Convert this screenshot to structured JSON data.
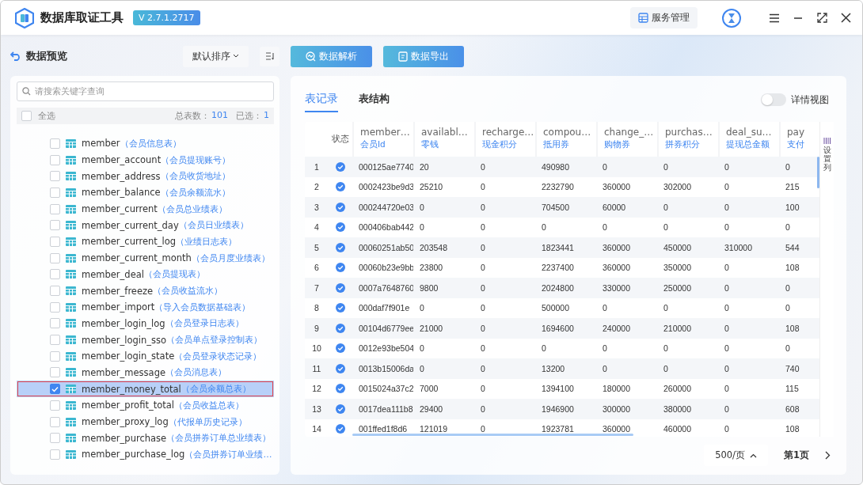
{
  "app": {
    "title": "数据库取证工具",
    "version": "V 2.7.1.2717",
    "service_button": "服务管理"
  },
  "sidebar": {
    "title": "数据预览",
    "sort": "默认排序",
    "search": {
      "placeholder": "请搜索关键字查询"
    },
    "select_all": {
      "label": "全选",
      "checked": false
    },
    "total_label": "总表数：",
    "total": "101",
    "selected_label": "已选：",
    "selected_count": "1",
    "items": [
      {
        "name": "member",
        "desc": "（会员信息表）",
        "checked": false,
        "selected": false
      },
      {
        "name": "member_account",
        "desc": "（会员提现账号）",
        "checked": false,
        "selected": false
      },
      {
        "name": "member_address",
        "desc": "（会员收货地址）",
        "checked": false,
        "selected": false
      },
      {
        "name": "member_balance",
        "desc": "（会员余额流水）",
        "checked": false,
        "selected": false
      },
      {
        "name": "member_current",
        "desc": "（会员总业绩表）",
        "checked": false,
        "selected": false
      },
      {
        "name": "member_current_day",
        "desc": "（会员日业绩表）",
        "checked": false,
        "selected": false
      },
      {
        "name": "member_current_log",
        "desc": "（业绩日志表）",
        "checked": false,
        "selected": false
      },
      {
        "name": "member_current_month",
        "desc": "（会员月度业绩表）",
        "checked": false,
        "selected": false
      },
      {
        "name": "member_deal",
        "desc": "（会员提现表）",
        "checked": false,
        "selected": false
      },
      {
        "name": "member_freeze",
        "desc": "（会员收益流水）",
        "checked": false,
        "selected": false
      },
      {
        "name": "member_import",
        "desc": "（导入会员数据基础表）",
        "checked": false,
        "selected": false
      },
      {
        "name": "member_login_log",
        "desc": "（会员登录日志表）",
        "checked": false,
        "selected": false
      },
      {
        "name": "member_login_sso",
        "desc": "（会员单点登录控制表）",
        "checked": false,
        "selected": false
      },
      {
        "name": "member_login_state",
        "desc": "（会员登录状态记录）",
        "checked": false,
        "selected": false
      },
      {
        "name": "member_message",
        "desc": "（会员消息表）",
        "checked": false,
        "selected": false
      },
      {
        "name": "member_money_total",
        "desc": "（会员余额总表）",
        "checked": true,
        "selected": true
      },
      {
        "name": "member_profit_total",
        "desc": "（会员收益总表）",
        "checked": false,
        "selected": false
      },
      {
        "name": "member_proxy_log",
        "desc": "（代报单历史记录）",
        "checked": false,
        "selected": false
      },
      {
        "name": "member_purchase",
        "desc": "（会员拼券订单总业绩表）",
        "checked": false,
        "selected": false
      },
      {
        "name": "member_purchase_log",
        "desc": "（会员拼券订单业绩…",
        "checked": false,
        "selected": false
      }
    ]
  },
  "toolbar": {
    "buttons": [
      "数据解析",
      "数据导出"
    ]
  },
  "tabs": [
    {
      "label": "表记录",
      "selected": true
    },
    {
      "label": "表结构",
      "selected": false
    }
  ],
  "detail_view": {
    "label": "详情视图",
    "on": false
  },
  "table": {
    "status_header": "状态",
    "settings_label": "设置列",
    "columns": [
      {
        "name": "member…",
        "desc": "会员Id"
      },
      {
        "name": "availabl…",
        "desc": "零钱"
      },
      {
        "name": "recharge…",
        "desc": "现金积分"
      },
      {
        "name": "compou…",
        "desc": "抵用券"
      },
      {
        "name": "change_…",
        "desc": "购物券"
      },
      {
        "name": "purchas…",
        "desc": "拼券积分"
      },
      {
        "name": "deal_su…",
        "desc": "提现总金额"
      },
      {
        "name": "pay",
        "desc": "支付"
      }
    ],
    "rows": [
      {
        "index": "1",
        "checked": true,
        "cells": [
          "000125ae7740",
          "20",
          "0",
          "490980",
          "0",
          "0",
          "0",
          "0"
        ]
      },
      {
        "index": "2",
        "checked": true,
        "cells": [
          "0002423be9d3",
          "25210",
          "0",
          "2232790",
          "360000",
          "302000",
          "0",
          "215"
        ]
      },
      {
        "index": "3",
        "checked": true,
        "cells": [
          "000244720e03",
          "0",
          "0",
          "704500",
          "60000",
          "0",
          "0",
          "100"
        ]
      },
      {
        "index": "4",
        "checked": true,
        "cells": [
          "000406bab442",
          "0",
          "0",
          "0",
          "0",
          "0",
          "0",
          "0"
        ]
      },
      {
        "index": "5",
        "checked": true,
        "cells": [
          "00060251ab50",
          "203548",
          "0",
          "1823441",
          "360000",
          "450000",
          "310000",
          "544"
        ]
      },
      {
        "index": "6",
        "checked": true,
        "cells": [
          "00060b23e9bb",
          "23800",
          "0",
          "2237400",
          "360000",
          "350000",
          "0",
          "108"
        ]
      },
      {
        "index": "7",
        "checked": true,
        "cells": [
          "0007a7648760",
          "9800",
          "0",
          "2024800",
          "330000",
          "250000",
          "0",
          "0"
        ]
      },
      {
        "index": "8",
        "checked": true,
        "cells": [
          "000daf7f901e",
          "0",
          "0",
          "500000",
          "0",
          "0",
          "0",
          "0"
        ]
      },
      {
        "index": "9",
        "checked": true,
        "cells": [
          "00104d6779ee",
          "21000",
          "0",
          "1694600",
          "240000",
          "210000",
          "0",
          "108"
        ]
      },
      {
        "index": "10",
        "checked": true,
        "cells": [
          "0012e93be504",
          "0",
          "0",
          "0",
          "0",
          "0",
          "0",
          "0"
        ]
      },
      {
        "index": "11",
        "checked": true,
        "cells": [
          "0013b15006da",
          "0",
          "0",
          "13200",
          "0",
          "0",
          "0",
          "740"
        ]
      },
      {
        "index": "12",
        "checked": true,
        "cells": [
          "0015024a37c2",
          "7000",
          "0",
          "1394100",
          "180000",
          "260000",
          "0",
          "115"
        ]
      },
      {
        "index": "13",
        "checked": true,
        "cells": [
          "0017dea111b8",
          "29400",
          "0",
          "1946900",
          "300000",
          "380000",
          "0",
          "608"
        ]
      },
      {
        "index": "14",
        "checked": true,
        "cells": [
          "001ffed1f8d6",
          "121019",
          "0",
          "1923781",
          "360000",
          "460000",
          "0",
          "108"
        ]
      }
    ]
  },
  "pagination": {
    "page_size": "500/页",
    "page": "第1页"
  }
}
